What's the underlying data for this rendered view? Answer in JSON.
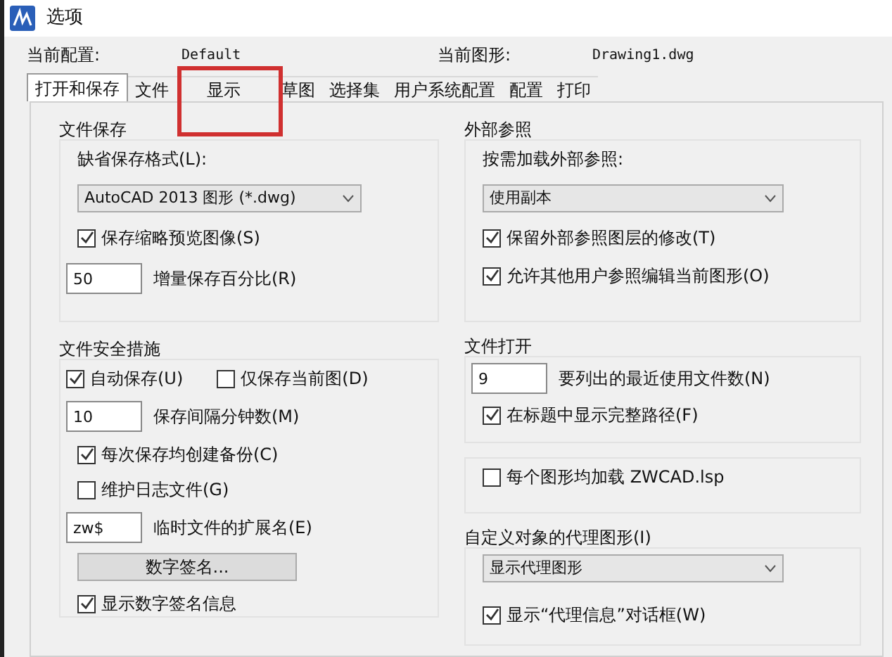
{
  "window": {
    "title": "选项"
  },
  "header": {
    "profile_label": "当前配置:",
    "profile_value": "Default",
    "drawing_label": "当前图形:",
    "drawing_value": "Drawing1.dwg"
  },
  "tabs": [
    {
      "label": "打开和保存",
      "selected": true
    },
    {
      "label": "文件",
      "selected": false
    },
    {
      "label": "显示",
      "selected": false
    },
    {
      "label": "草图",
      "selected": false
    },
    {
      "label": "选择集",
      "selected": false
    },
    {
      "label": "用户系统配置",
      "selected": false
    },
    {
      "label": "配置",
      "selected": false
    },
    {
      "label": "打印",
      "selected": false
    }
  ],
  "annotation": {
    "kind": "highlight-frame"
  },
  "left_groups": [
    {
      "title": "文件保存",
      "items": [
        {
          "kind": "label",
          "text": "缺省保存格式(L):"
        },
        {
          "kind": "select",
          "value": "AutoCAD 2013 图形 (*.dwg)"
        },
        {
          "kind": "checkbox",
          "label": "保存缩略预览图像(S)",
          "checked": true
        },
        {
          "kind": "input",
          "value": "50",
          "text": "增量保存百分比(R)"
        }
      ]
    },
    {
      "title": "文件安全措施",
      "items": [
        {
          "kind": "checkpair",
          "a": {
            "label": "自动保存(U)",
            "checked": true
          },
          "b": {
            "label": "仅保存当前图(D)",
            "checked": false
          }
        },
        {
          "kind": "input",
          "value": "10",
          "text": "保存间隔分钟数(M)"
        },
        {
          "kind": "checkbox",
          "label": "每次保存均创建备份(C)",
          "checked": true
        },
        {
          "kind": "checkbox",
          "label": "维护日志文件(G)",
          "checked": false
        },
        {
          "kind": "input",
          "value": "zw$",
          "text": "临时文件的扩展名(E)"
        },
        {
          "kind": "button",
          "label": "数字签名..."
        },
        {
          "kind": "checkbox",
          "label": "显示数字签名信息",
          "checked": true
        }
      ]
    }
  ],
  "right_groups": [
    {
      "title": "外部参照",
      "items": [
        {
          "kind": "label",
          "text": "按需加载外部参照:"
        },
        {
          "kind": "select",
          "value": "使用副本"
        },
        {
          "kind": "checkbox",
          "label": "保留外部参照图层的修改(T)",
          "checked": true
        },
        {
          "kind": "checkbox",
          "label": "允许其他用户参照编辑当前图形(O)",
          "checked": true
        }
      ]
    },
    {
      "title": "文件打开",
      "items": [
        {
          "kind": "input",
          "value": "9",
          "text": "要列出的最近使用文件数(N)"
        },
        {
          "kind": "checkbox",
          "label": "在标题中显示完整路径(F)",
          "checked": true
        }
      ]
    },
    {
      "items": [
        {
          "kind": "checkbox",
          "label": "每个图形均加载 ZWCAD.lsp",
          "checked": false
        }
      ]
    },
    {
      "title": "自定义对象的代理图形(I)",
      "items": [
        {
          "kind": "select",
          "value": "显示代理图形"
        },
        {
          "kind": "checkbox",
          "label": "显示“代理信息”对话框(W)",
          "checked": true
        }
      ]
    }
  ]
}
